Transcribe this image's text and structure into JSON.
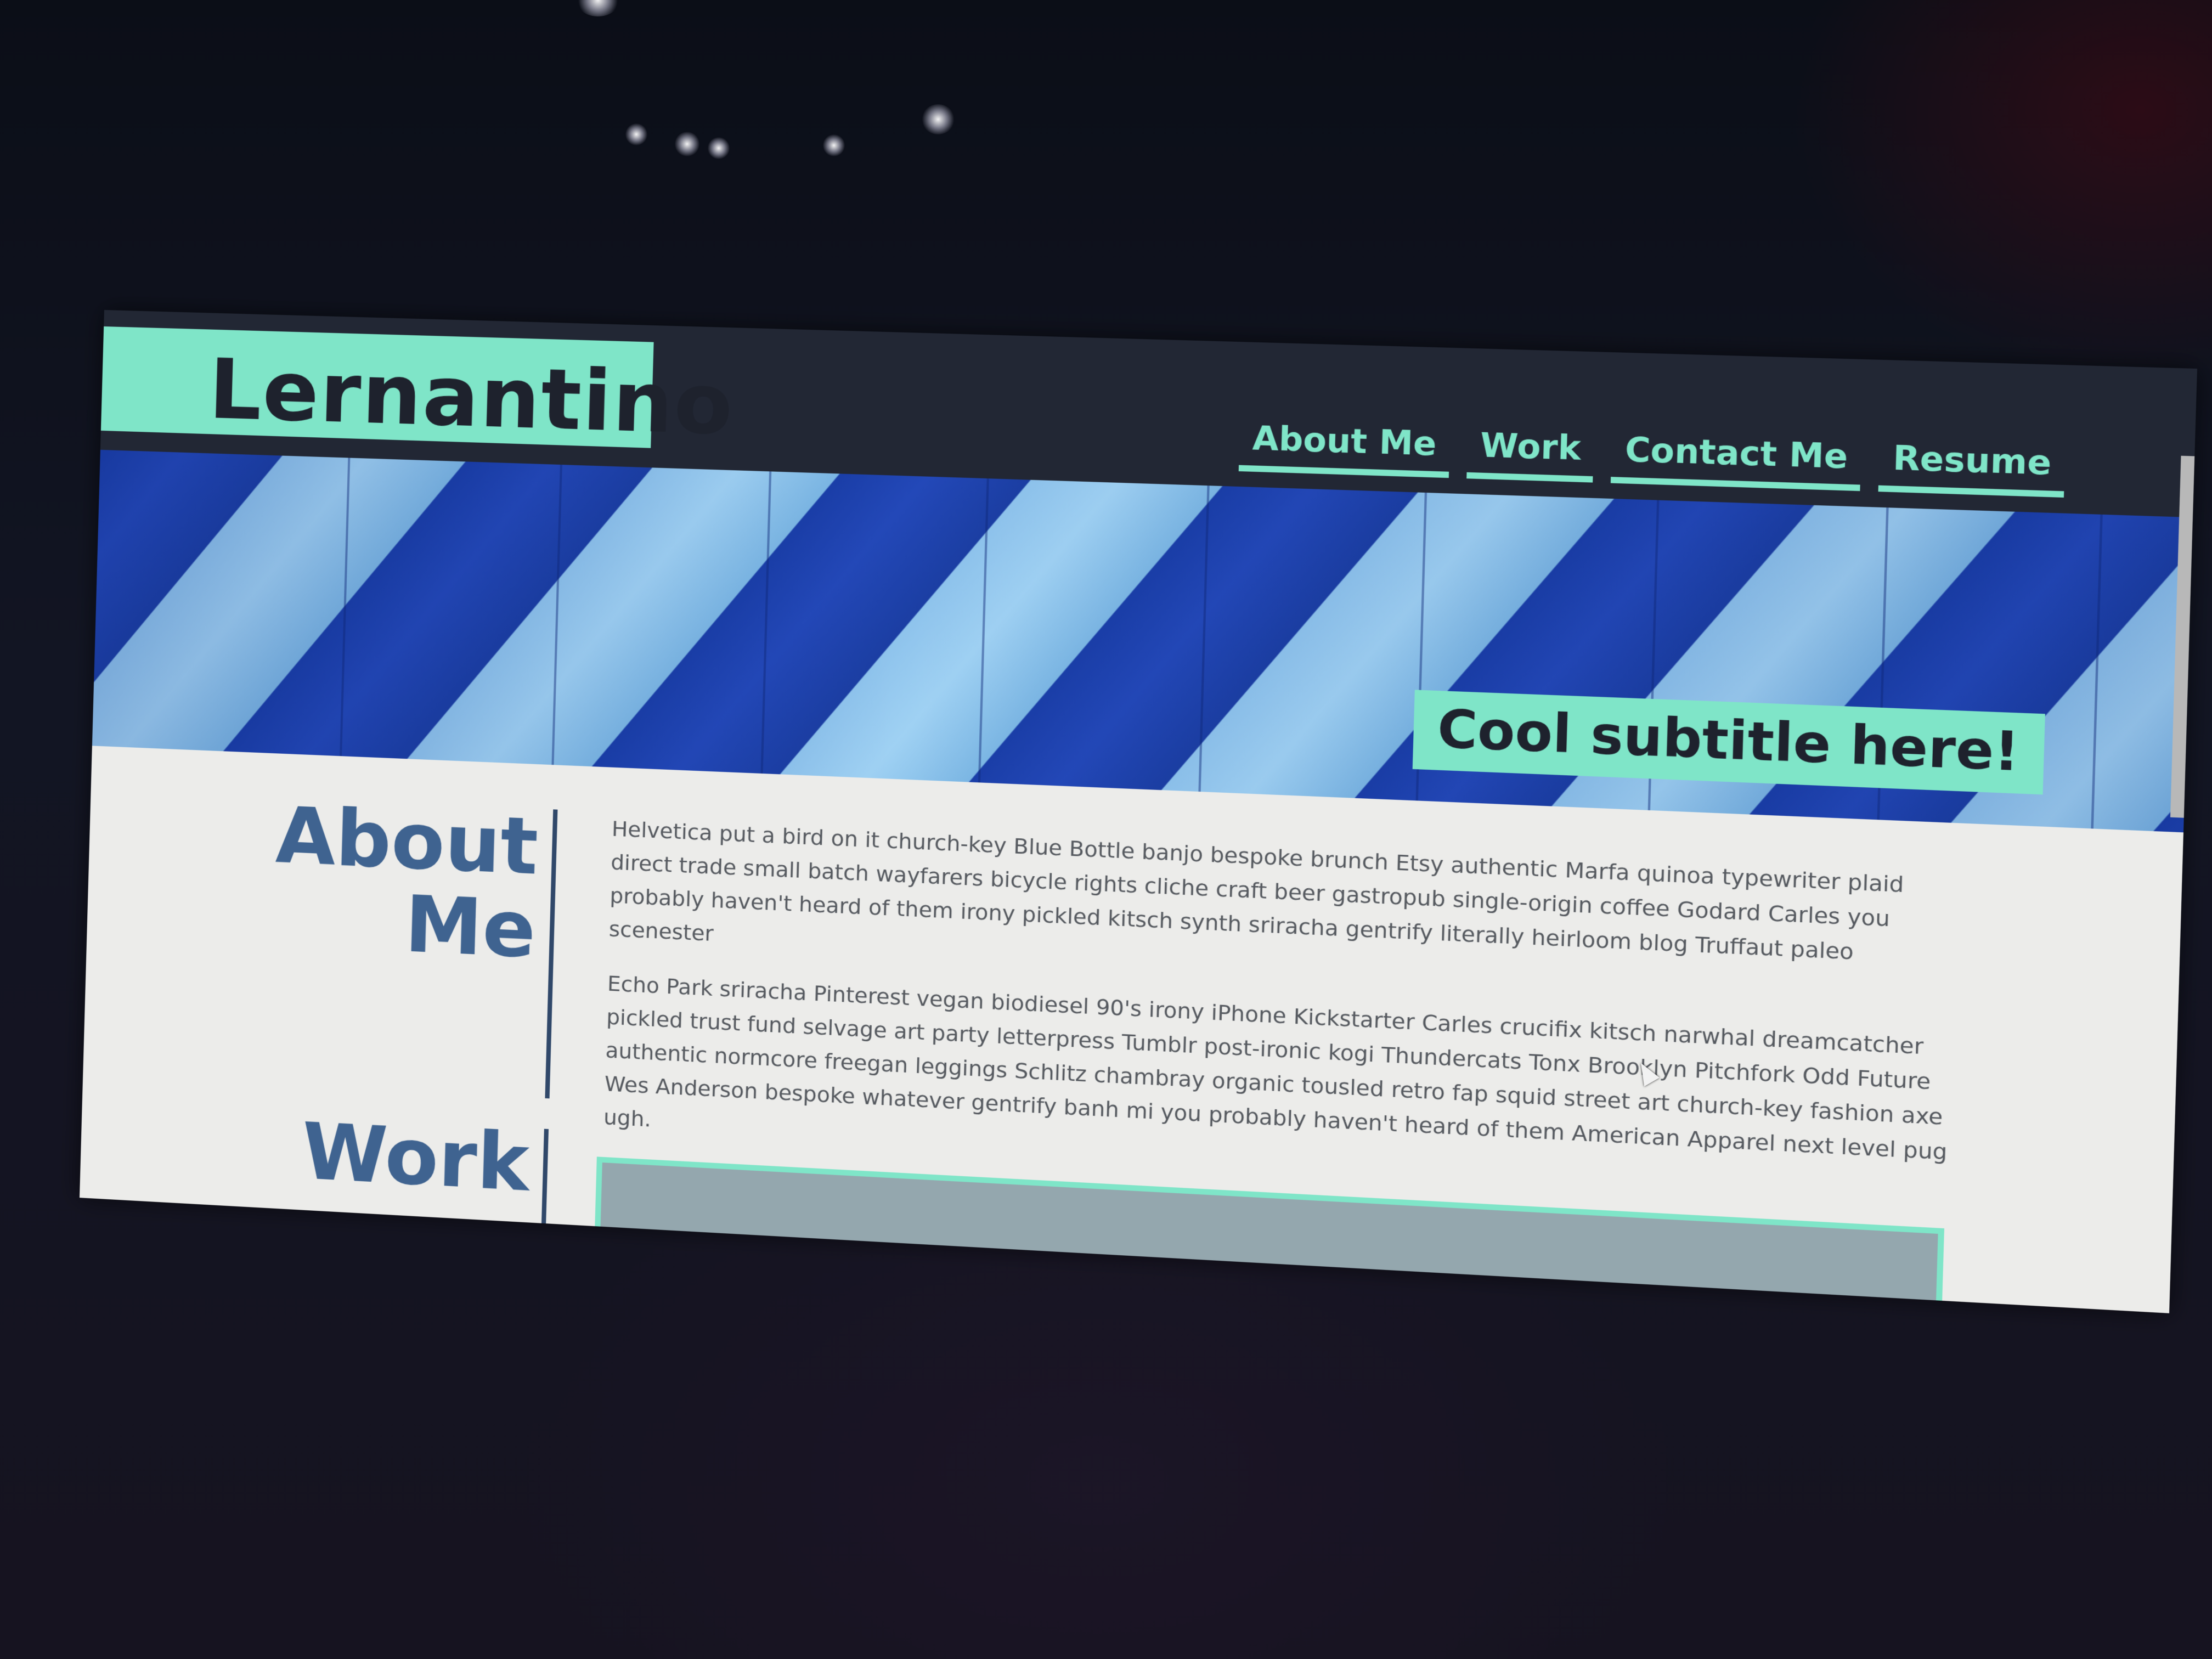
{
  "site": {
    "logo": "Lernantino"
  },
  "nav": {
    "items": [
      {
        "label": "About Me"
      },
      {
        "label": "Work"
      },
      {
        "label": "Contact Me"
      },
      {
        "label": "Resume"
      }
    ]
  },
  "hero": {
    "subtitle": "Cool subtitle here!"
  },
  "about": {
    "heading_line1": "About",
    "heading_line2": "Me",
    "paragraphs": [
      "Helvetica put a bird on it church-key Blue Bottle banjo bespoke brunch Etsy authentic Marfa quinoa typewriter plaid direct trade small batch wayfarers bicycle rights cliche craft beer gastropub single-origin coffee Godard Carles you probably haven't heard of them irony pickled kitsch synth sriracha gentrify literally heirloom blog Truffaut paleo scenester",
      "Echo Park sriracha Pinterest vegan biodiesel 90's irony iPhone Kickstarter Carles crucifix kitsch narwhal dreamcatcher pickled trust fund selvage art party letterpress Tumblr post-ironic kogi Thundercats Tonx Brooklyn Pitchfork Odd Future authentic normcore freegan leggings Schlitz chambray organic tousled retro fap squid street art church-key fashion axe Wes Anderson bespoke whatever gentrify banh mi you probably haven't heard of them American Apparel next level pug ugh."
    ]
  },
  "work": {
    "heading": "Work"
  },
  "colors": {
    "accent": "#7fe5c8",
    "header_bg": "#222734",
    "heading": "#3f6390",
    "body_text": "#55595f"
  }
}
